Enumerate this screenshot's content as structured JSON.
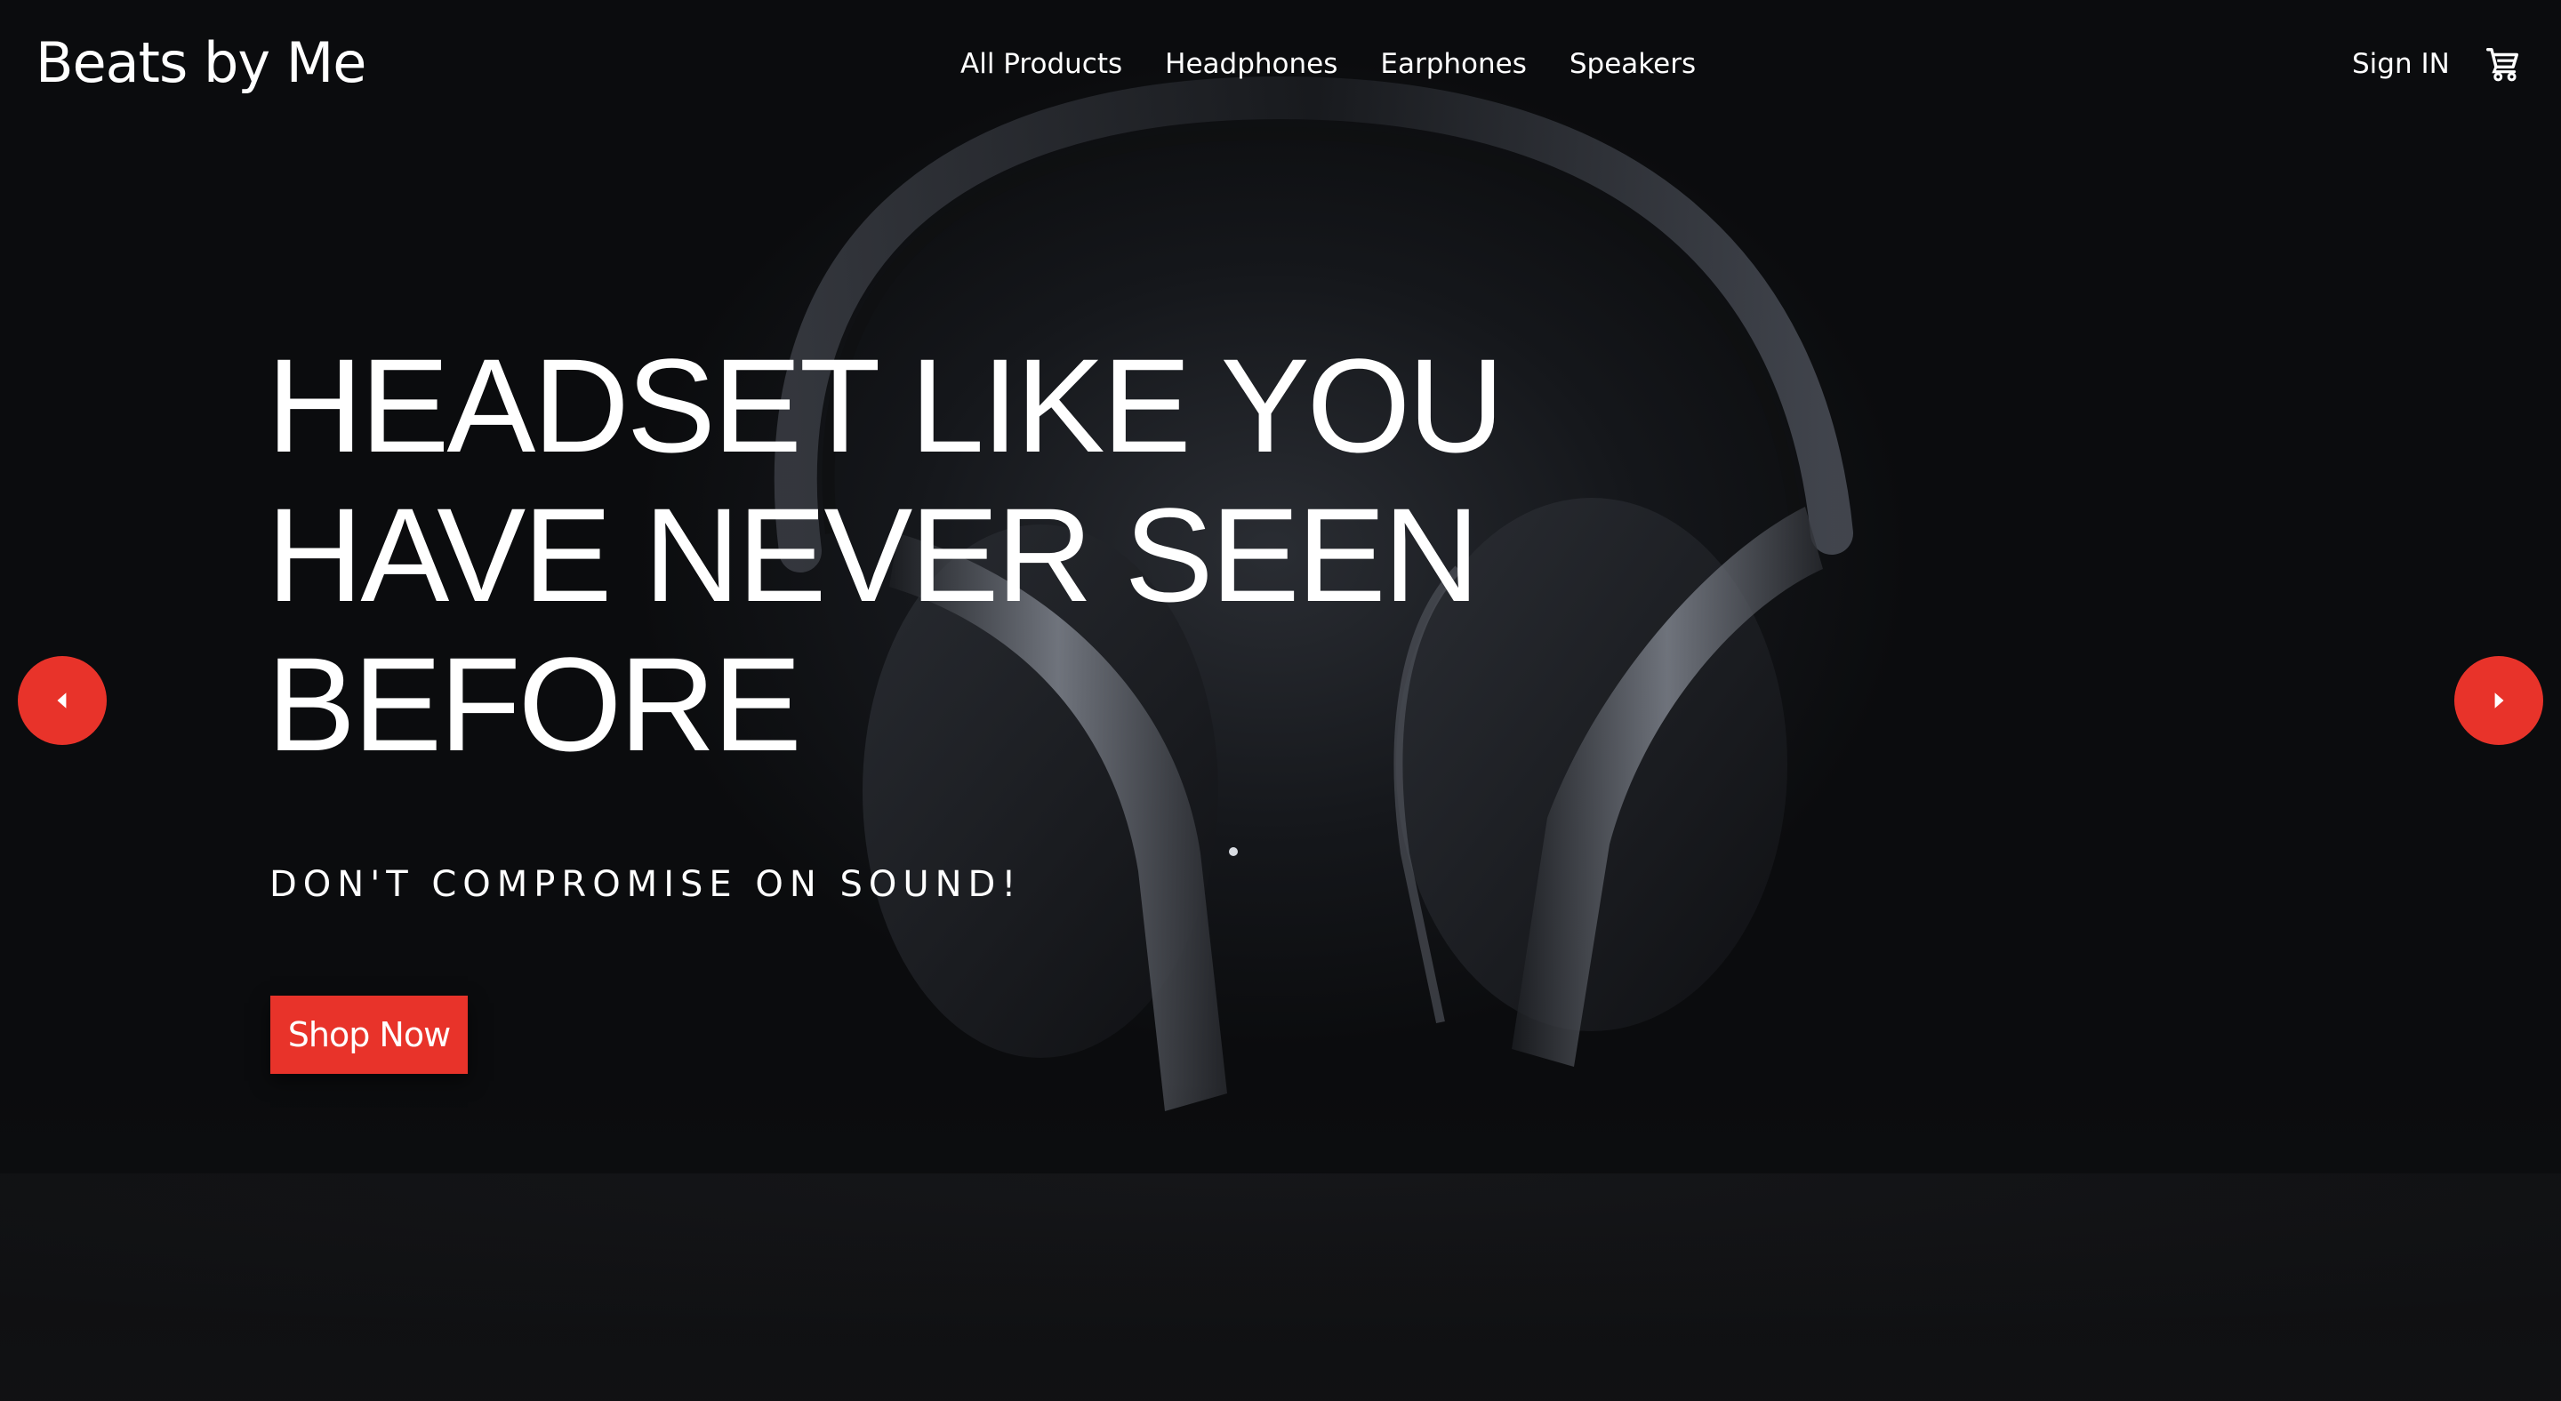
{
  "brand": {
    "name": "Beats by Me"
  },
  "nav": {
    "links": [
      {
        "label": "All Products"
      },
      {
        "label": "Headphones"
      },
      {
        "label": "Earphones"
      },
      {
        "label": "Speakers"
      }
    ],
    "sign_in": "Sign IN",
    "cart_icon": "cart-icon"
  },
  "hero": {
    "headline_lines": [
      "HEADSET LIKE YOU",
      "HAVE NEVER SEEN",
      "BEFORE"
    ],
    "tagline": "DON'T COMPROMISE ON SOUND!",
    "cta_label": "Shop Now",
    "prev_icon": "chevron-left-icon",
    "next_icon": "chevron-right-icon"
  },
  "colors": {
    "accent": "#e8332a",
    "background": "#0b0c0e",
    "text": "#ffffff"
  }
}
